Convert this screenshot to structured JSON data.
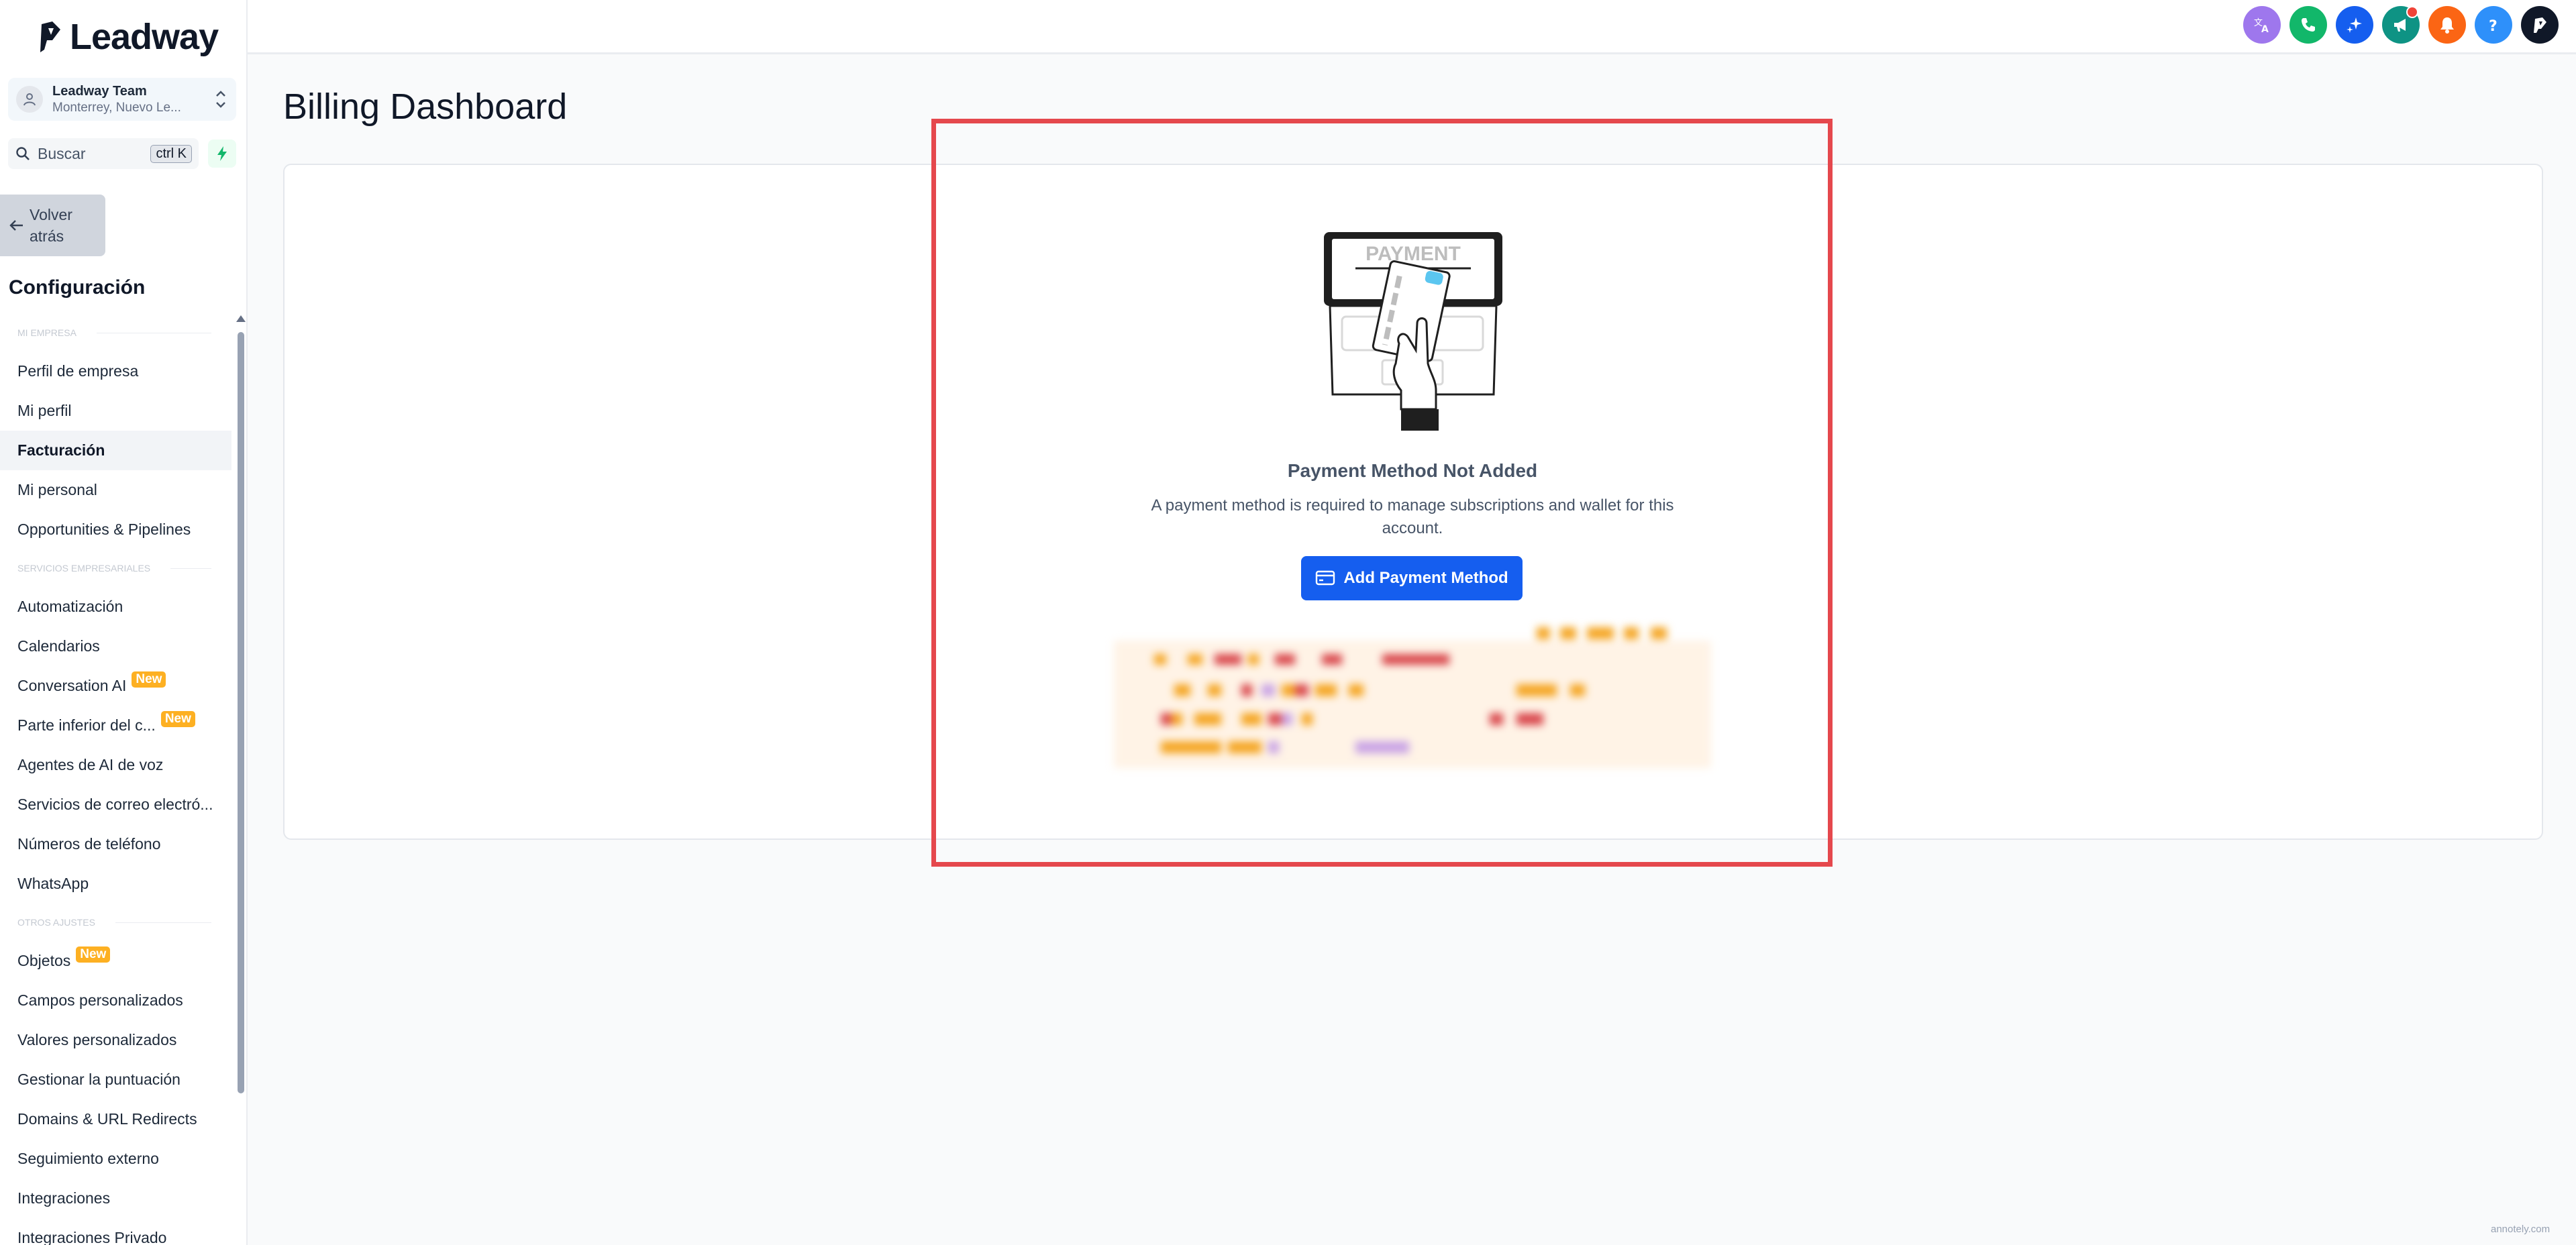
{
  "brand": {
    "name": "Leadway"
  },
  "account": {
    "name": "Leadway Team",
    "location": "Monterrey, Nuevo Le..."
  },
  "search": {
    "placeholder": "Buscar",
    "shortcut": "ctrl K"
  },
  "back_button": {
    "label": "Volver atrás"
  },
  "settings": {
    "title": "Configuración"
  },
  "sidebar": {
    "groups": [
      {
        "label": "MI EMPRESA",
        "items": [
          {
            "label": "Perfil de empresa"
          },
          {
            "label": "Mi perfil"
          },
          {
            "label": "Facturación",
            "active": true
          },
          {
            "label": "Mi personal"
          },
          {
            "label": "Opportunities & Pipelines"
          }
        ]
      },
      {
        "label": "SERVICIOS EMPRESARIALES",
        "items": [
          {
            "label": "Automatización"
          },
          {
            "label": "Calendarios"
          },
          {
            "label": "Conversation AI",
            "badge": "New"
          },
          {
            "label": "Parte inferior del c...",
            "badge": "New"
          },
          {
            "label": "Agentes de AI de voz"
          },
          {
            "label": "Servicios de correo electró..."
          },
          {
            "label": "Números de teléfono"
          },
          {
            "label": "WhatsApp"
          }
        ]
      },
      {
        "label": "OTROS AJUSTES",
        "items": [
          {
            "label": "Objetos",
            "badge": "New"
          },
          {
            "label": "Campos personalizados"
          },
          {
            "label": "Valores personalizados"
          },
          {
            "label": "Gestionar la puntuación"
          },
          {
            "label": "Domains & URL Redirects"
          },
          {
            "label": "Seguimiento externo"
          },
          {
            "label": "Integraciones"
          },
          {
            "label": "Integraciones Privado"
          }
        ]
      }
    ]
  },
  "topbar": {
    "icons": [
      {
        "name": "translate-icon",
        "color": "#9e77ed"
      },
      {
        "name": "phone-icon",
        "color": "#12b76a"
      },
      {
        "name": "sparkle-icon",
        "color": "#155eef"
      },
      {
        "name": "megaphone-icon",
        "color": "#0e9384",
        "dot": true
      },
      {
        "name": "bell-icon",
        "color": "#fb6514"
      },
      {
        "name": "help-icon",
        "color": "#2e90fa"
      },
      {
        "name": "user-logo-icon",
        "color": "#101828"
      }
    ]
  },
  "main": {
    "title": "Billing Dashboard",
    "illustration_text": "PAYMENT",
    "empty_title": "Payment Method Not Added",
    "empty_description": "A payment method is required to manage subscriptions and wallet for this account.",
    "add_button": "Add Payment Method"
  },
  "colors": {
    "accent": "#155eef",
    "highlight": "#e5484d",
    "badge": "#fdb022"
  },
  "watermark": "annotely.com"
}
